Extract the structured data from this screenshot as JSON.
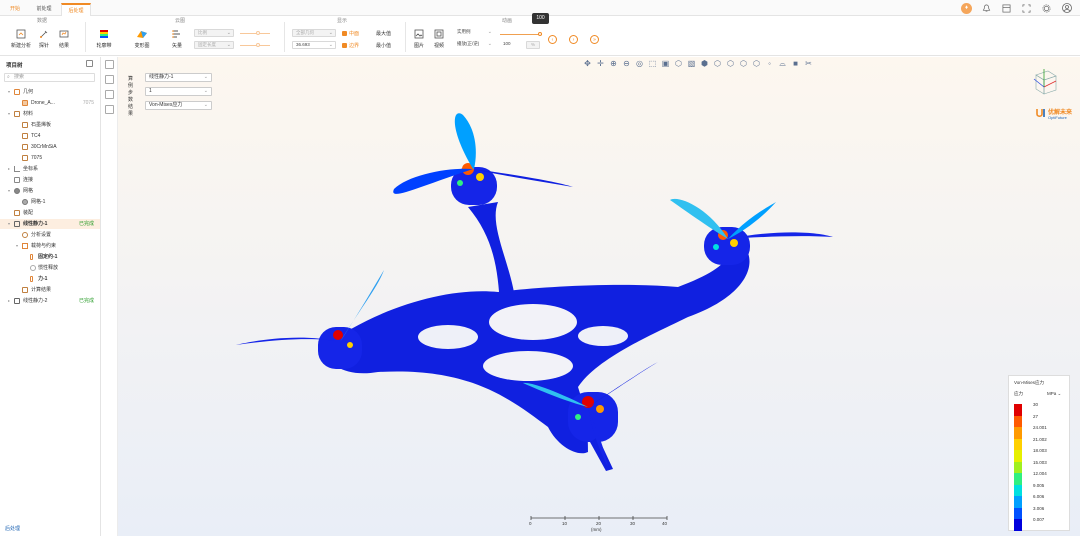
{
  "tabs": [
    {
      "label": "开始"
    },
    {
      "label": "前处理"
    },
    {
      "label": "后处理"
    }
  ],
  "ribbon": {
    "groups": {
      "data": "数据",
      "cloud": "云图",
      "display": "显示",
      "animation": "动画"
    },
    "buttons": {
      "new_analysis": "新建分析",
      "probe": "探针",
      "results": "结果",
      "contour": "轮廓带",
      "deform": "变形图",
      "vector": "矢量",
      "image": "图片",
      "video": "视频"
    },
    "vector_options": {
      "ratio": "比例",
      "fixed_length": "固定长度"
    },
    "display": {
      "all_parts": "全部几何",
      "scale_value": "36.693",
      "mid_section": "中面",
      "boundary": "边界",
      "max_value": "最大值",
      "min_value": "最小值"
    },
    "animation": {
      "mode": "实用例",
      "play_type": "播放(正/逆)",
      "frames": "100",
      "unit": "%",
      "tooltip": "100"
    }
  },
  "left": {
    "title": "项目树",
    "search_placeholder": "搜索",
    "tree": [
      {
        "label": "几何",
        "tag": ""
      },
      {
        "label": "Drone_A...",
        "tag": "7075"
      },
      {
        "label": "材料",
        "tag": ""
      },
      {
        "label": "石墨烯板",
        "tag": ""
      },
      {
        "label": "TC4",
        "tag": ""
      },
      {
        "label": "30CrMnSiA",
        "tag": ""
      },
      {
        "label": "7075",
        "tag": ""
      },
      {
        "label": "坐标系",
        "tag": ""
      },
      {
        "label": "连接",
        "tag": ""
      },
      {
        "label": "网格",
        "tag": ""
      },
      {
        "label": "网格-1",
        "tag": ""
      },
      {
        "label": "装配",
        "tag": ""
      },
      {
        "label": "线性静力-1",
        "tag": "已完成"
      },
      {
        "label": "分析设置",
        "tag": ""
      },
      {
        "label": "载荷与约束",
        "tag": ""
      },
      {
        "label": "固定约-1",
        "tag": ""
      },
      {
        "label": "惯性释放",
        "tag": ""
      },
      {
        "label": "力-1",
        "tag": ""
      },
      {
        "label": "计算结果",
        "tag": ""
      },
      {
        "label": "线性静力-2",
        "tag": "已完成"
      }
    ]
  },
  "viewport": {
    "selectors": [
      {
        "label": "算例",
        "value": "线性静力-1"
      },
      {
        "label": "步数",
        "value": "1"
      },
      {
        "label": "结果",
        "value": "Von-Mises应力"
      }
    ],
    "logo": {
      "name": "优解未来",
      "sub": "OptiFuture"
    },
    "legend": {
      "title": "Von-Mises应力",
      "quantity": "应力",
      "unit": "MPa",
      "values": [
        "30",
        "27",
        "24.001",
        "21.002",
        "18.003",
        "15.003",
        "12.004",
        "9.005",
        "6.006",
        "3.006",
        "0.007"
      ],
      "colors": [
        "#e00000",
        "#ff5a00",
        "#ff9a00",
        "#ffd000",
        "#e6f000",
        "#a0f020",
        "#30f080",
        "#00e0e0",
        "#00a0ff",
        "#0050ff",
        "#0000dd"
      ]
    },
    "scale": {
      "ticks": [
        "0",
        "10",
        "20",
        "30",
        "40"
      ],
      "unit": "(mm)"
    },
    "status": "后处理"
  },
  "colors": {
    "accent": "#f08a24",
    "mesh": "#1020e0"
  }
}
